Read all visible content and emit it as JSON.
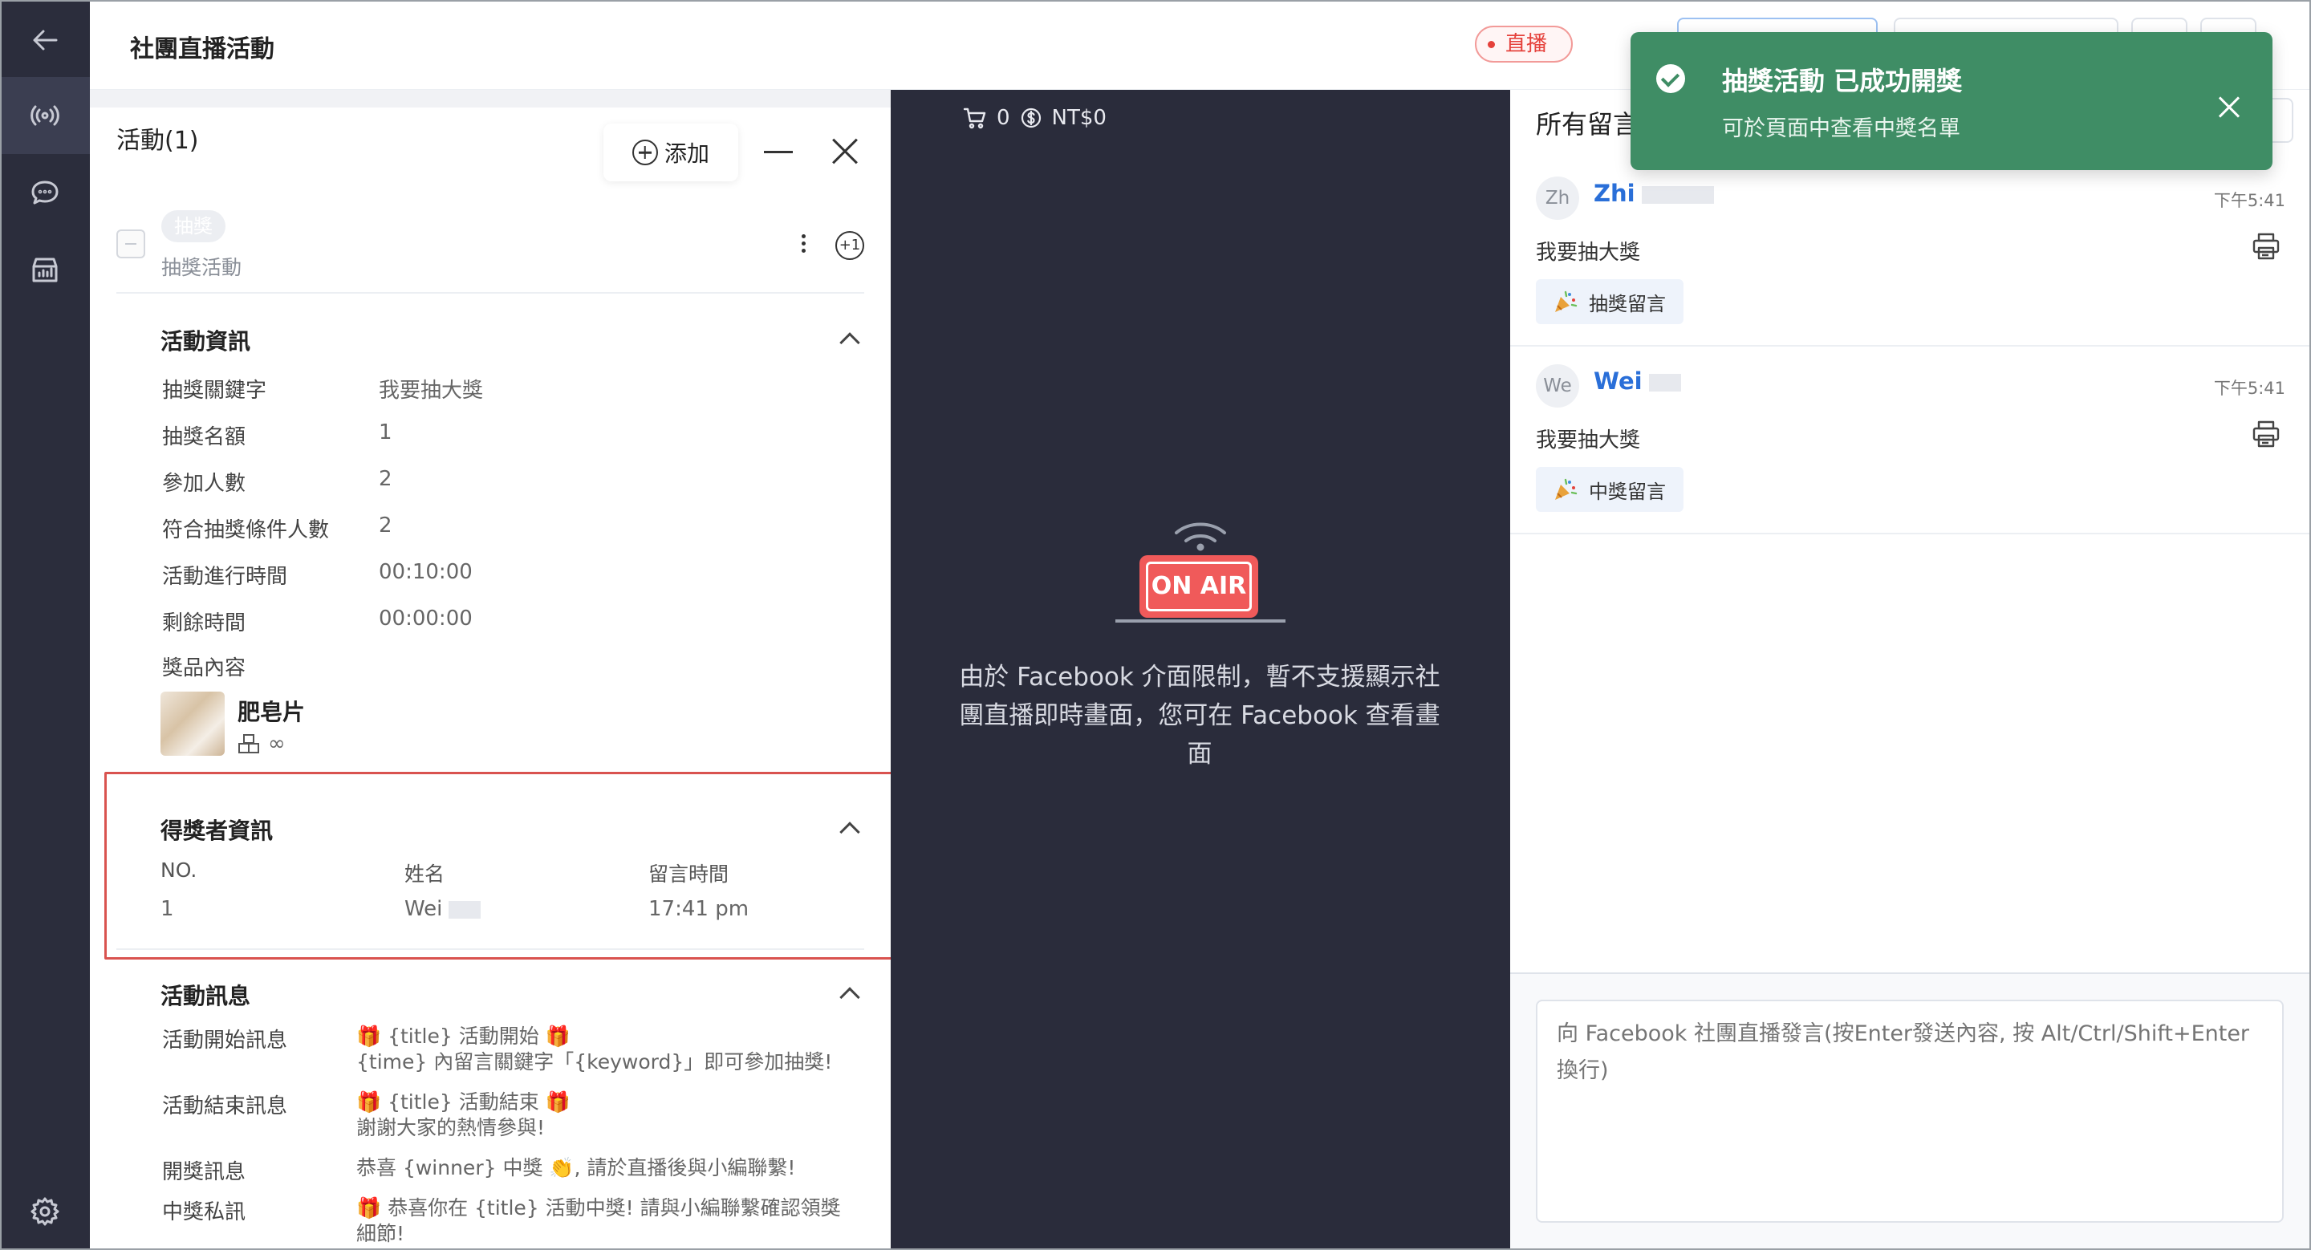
{
  "header": {
    "title": "社團直播活動",
    "live_badge": "直播"
  },
  "rail": {
    "items": [
      "back-arrow-icon",
      "broadcast-icon",
      "chat-icon",
      "shop-icon",
      "settings-icon"
    ]
  },
  "activities": {
    "heading": "活動(1)",
    "add_label": "添加",
    "item": {
      "tag": "抽獎",
      "name": "抽獎活動",
      "plus_label": "+1"
    }
  },
  "activity_info": {
    "title": "活動資訊",
    "rows": [
      {
        "label": "抽獎關鍵字",
        "value": "我要抽大獎"
      },
      {
        "label": "抽獎名額",
        "value": "1"
      },
      {
        "label": "參加人數",
        "value": "2"
      },
      {
        "label": "符合抽獎條件人數",
        "value": "2"
      },
      {
        "label": "活動進行時間",
        "value": "00:10:00"
      },
      {
        "label": "剩餘時間",
        "value": "00:00:00"
      }
    ],
    "prize_label": "獎品內容",
    "prize_name": "肥皂片",
    "prize_stock": "∞"
  },
  "winner_info": {
    "title": "得獎者資訊",
    "columns": [
      "NO.",
      "姓名",
      "留言時間"
    ],
    "rows": [
      {
        "no": "1",
        "name": "Wei",
        "time": "17:41 pm"
      }
    ]
  },
  "activity_messages": {
    "title": "活動訊息",
    "rows": [
      {
        "label": "活動開始訊息",
        "line1": "🎁 {title} 活動開始 🎁",
        "line2": "{time} 內留言關鍵字「{keyword}」即可參加抽獎!"
      },
      {
        "label": "活動結束訊息",
        "line1": "🎁 {title} 活動結束 🎁",
        "line2": "謝謝大家的熱情參與!"
      },
      {
        "label": "開獎訊息",
        "line1": "恭喜 {winner} 中獎 👏, 請於直播後與小編聯繫!",
        "line2": ""
      },
      {
        "label": "中獎私訊",
        "line1": "🎁 恭喜你在 {title} 活動中獎! 請與小編聯繫確認領獎",
        "line2": "細節!"
      }
    ]
  },
  "center": {
    "cart_count": "0",
    "cart_total": "NT$0",
    "onair_label": "ON AIR",
    "message": "由於 Facebook 介面限制，暫不支援顯示社團直播即時畫面，您可在 Facebook 查看畫面"
  },
  "comments": {
    "heading": "所有留言",
    "items": [
      {
        "initials": "Zh",
        "name": "Zhi",
        "time": "下午5:41",
        "text": "我要抽大獎",
        "tag": "抽獎留言"
      },
      {
        "initials": "We",
        "name": "Wei",
        "time": "下午5:41",
        "text": "我要抽大獎",
        "tag": "中獎留言"
      }
    ],
    "input_placeholder": "向 Facebook 社團直播發言(按Enter發送內容, 按 Alt/Ctrl/Shift+Enter 換行)"
  },
  "toast": {
    "title": "抽獎活動 已成功開獎",
    "body": "可於頁面中查看中獎名單"
  },
  "colors": {
    "rail_bg": "#2b2d3c",
    "center_bg": "#2a2c3b",
    "accent_blue": "#2a6fd8",
    "toast_green": "#3f8d65",
    "live_red": "#e5413b",
    "highlight_red": "#d9534f"
  }
}
